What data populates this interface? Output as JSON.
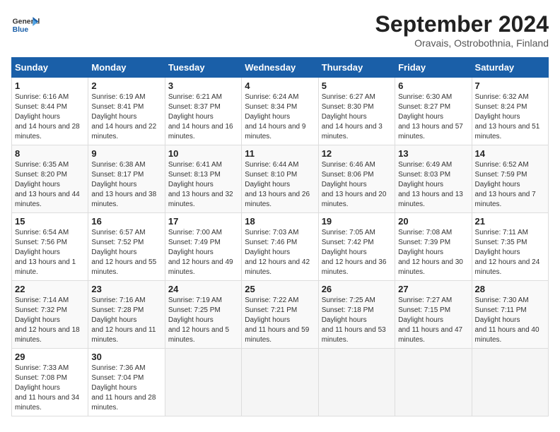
{
  "header": {
    "logo_general": "General",
    "logo_blue": "Blue",
    "month": "September 2024",
    "location": "Oravais, Ostrobothnia, Finland"
  },
  "columns": [
    "Sunday",
    "Monday",
    "Tuesday",
    "Wednesday",
    "Thursday",
    "Friday",
    "Saturday"
  ],
  "weeks": [
    [
      {
        "day": "1",
        "rise": "6:16 AM",
        "set": "8:44 PM",
        "daylight": "14 hours and 28 minutes."
      },
      {
        "day": "2",
        "rise": "6:19 AM",
        "set": "8:41 PM",
        "daylight": "14 hours and 22 minutes."
      },
      {
        "day": "3",
        "rise": "6:21 AM",
        "set": "8:37 PM",
        "daylight": "14 hours and 16 minutes."
      },
      {
        "day": "4",
        "rise": "6:24 AM",
        "set": "8:34 PM",
        "daylight": "14 hours and 9 minutes."
      },
      {
        "day": "5",
        "rise": "6:27 AM",
        "set": "8:30 PM",
        "daylight": "14 hours and 3 minutes."
      },
      {
        "day": "6",
        "rise": "6:30 AM",
        "set": "8:27 PM",
        "daylight": "13 hours and 57 minutes."
      },
      {
        "day": "7",
        "rise": "6:32 AM",
        "set": "8:24 PM",
        "daylight": "13 hours and 51 minutes."
      }
    ],
    [
      {
        "day": "8",
        "rise": "6:35 AM",
        "set": "8:20 PM",
        "daylight": "13 hours and 44 minutes."
      },
      {
        "day": "9",
        "rise": "6:38 AM",
        "set": "8:17 PM",
        "daylight": "13 hours and 38 minutes."
      },
      {
        "day": "10",
        "rise": "6:41 AM",
        "set": "8:13 PM",
        "daylight": "13 hours and 32 minutes."
      },
      {
        "day": "11",
        "rise": "6:44 AM",
        "set": "8:10 PM",
        "daylight": "13 hours and 26 minutes."
      },
      {
        "day": "12",
        "rise": "6:46 AM",
        "set": "8:06 PM",
        "daylight": "13 hours and 20 minutes."
      },
      {
        "day": "13",
        "rise": "6:49 AM",
        "set": "8:03 PM",
        "daylight": "13 hours and 13 minutes."
      },
      {
        "day": "14",
        "rise": "6:52 AM",
        "set": "7:59 PM",
        "daylight": "13 hours and 7 minutes."
      }
    ],
    [
      {
        "day": "15",
        "rise": "6:54 AM",
        "set": "7:56 PM",
        "daylight": "13 hours and 1 minute."
      },
      {
        "day": "16",
        "rise": "6:57 AM",
        "set": "7:52 PM",
        "daylight": "12 hours and 55 minutes."
      },
      {
        "day": "17",
        "rise": "7:00 AM",
        "set": "7:49 PM",
        "daylight": "12 hours and 49 minutes."
      },
      {
        "day": "18",
        "rise": "7:03 AM",
        "set": "7:46 PM",
        "daylight": "12 hours and 42 minutes."
      },
      {
        "day": "19",
        "rise": "7:05 AM",
        "set": "7:42 PM",
        "daylight": "12 hours and 36 minutes."
      },
      {
        "day": "20",
        "rise": "7:08 AM",
        "set": "7:39 PM",
        "daylight": "12 hours and 30 minutes."
      },
      {
        "day": "21",
        "rise": "7:11 AM",
        "set": "7:35 PM",
        "daylight": "12 hours and 24 minutes."
      }
    ],
    [
      {
        "day": "22",
        "rise": "7:14 AM",
        "set": "7:32 PM",
        "daylight": "12 hours and 18 minutes."
      },
      {
        "day": "23",
        "rise": "7:16 AM",
        "set": "7:28 PM",
        "daylight": "12 hours and 11 minutes."
      },
      {
        "day": "24",
        "rise": "7:19 AM",
        "set": "7:25 PM",
        "daylight": "12 hours and 5 minutes."
      },
      {
        "day": "25",
        "rise": "7:22 AM",
        "set": "7:21 PM",
        "daylight": "11 hours and 59 minutes."
      },
      {
        "day": "26",
        "rise": "7:25 AM",
        "set": "7:18 PM",
        "daylight": "11 hours and 53 minutes."
      },
      {
        "day": "27",
        "rise": "7:27 AM",
        "set": "7:15 PM",
        "daylight": "11 hours and 47 minutes."
      },
      {
        "day": "28",
        "rise": "7:30 AM",
        "set": "7:11 PM",
        "daylight": "11 hours and 40 minutes."
      }
    ],
    [
      {
        "day": "29",
        "rise": "7:33 AM",
        "set": "7:08 PM",
        "daylight": "11 hours and 34 minutes."
      },
      {
        "day": "30",
        "rise": "7:36 AM",
        "set": "7:04 PM",
        "daylight": "11 hours and 28 minutes."
      },
      null,
      null,
      null,
      null,
      null
    ]
  ]
}
